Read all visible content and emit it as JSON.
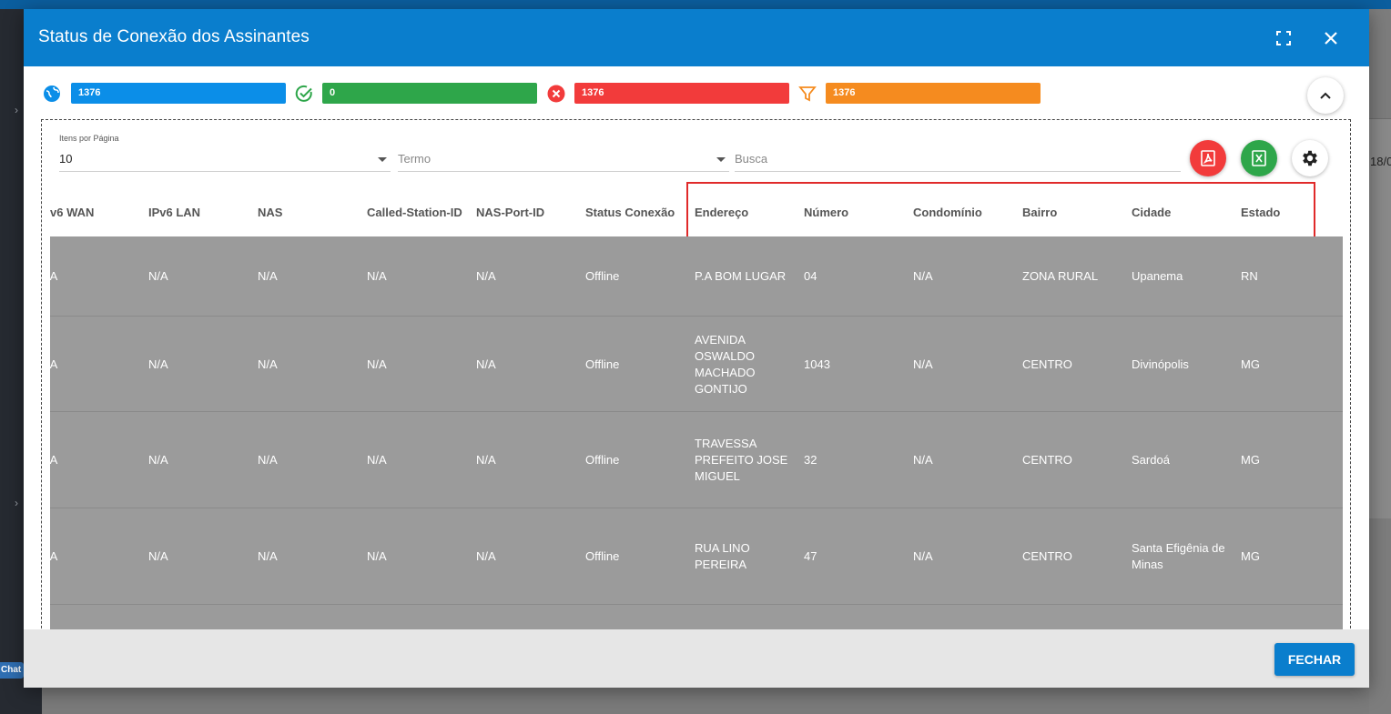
{
  "modal": {
    "title": "Status de Conexão dos Assinantes",
    "close_button": "FECHAR"
  },
  "stats": [
    {
      "icon": "globe-icon",
      "value": "1376",
      "color": "#0b8ee8"
    },
    {
      "icon": "check-circle-icon",
      "value": "0",
      "color": "#2ea64a"
    },
    {
      "icon": "x-circle-icon",
      "value": "1376",
      "color": "#f23b3b"
    },
    {
      "icon": "filter-icon",
      "value": "1376",
      "color": "#f58b1f"
    }
  ],
  "filters": {
    "items_per_page_label": "Itens por Página",
    "items_per_page_value": "10",
    "term_placeholder": "Termo",
    "search_placeholder": "Busca"
  },
  "background": {
    "right_partial_text": "18/0",
    "chat_label": "Chat"
  },
  "table": {
    "headers": [
      "v6 WAN",
      "IPv6 LAN",
      "NAS",
      "Called-Station-ID",
      "NAS-Port-ID",
      "Status Conexão",
      "Endereço",
      "Número",
      "Condomínio",
      "Bairro",
      "Cidade",
      "Estado"
    ],
    "rows": [
      {
        "cells": [
          "/A",
          "N/A",
          "N/A",
          "N/A",
          "N/A",
          "Offline",
          [
            "P.A BOM LUGAR"
          ],
          "04",
          "N/A",
          "ZONA RURAL",
          [
            "Upanema"
          ],
          "RN"
        ]
      },
      {
        "cells": [
          "/A",
          "N/A",
          "N/A",
          "N/A",
          "N/A",
          "Offline",
          [
            "AVENIDA",
            "OSWALDO",
            "MACHADO",
            "GONTIJO"
          ],
          "1043",
          "N/A",
          "CENTRO",
          [
            "Divinópolis"
          ],
          "MG"
        ]
      },
      {
        "cells": [
          "/A",
          "N/A",
          "N/A",
          "N/A",
          "N/A",
          "Offline",
          [
            "TRAVESSA",
            "PREFEITO JOSE",
            "MIGUEL"
          ],
          "32",
          "N/A",
          "CENTRO",
          [
            "Sardoá"
          ],
          "MG"
        ]
      },
      {
        "cells": [
          "/A",
          "N/A",
          "N/A",
          "N/A",
          "N/A",
          "Offline",
          [
            "RUA LINO",
            "PEREIRA"
          ],
          "47",
          "N/A",
          "CENTRO",
          [
            "Santa Efigênia de",
            "Minas"
          ],
          "MG"
        ]
      }
    ]
  }
}
